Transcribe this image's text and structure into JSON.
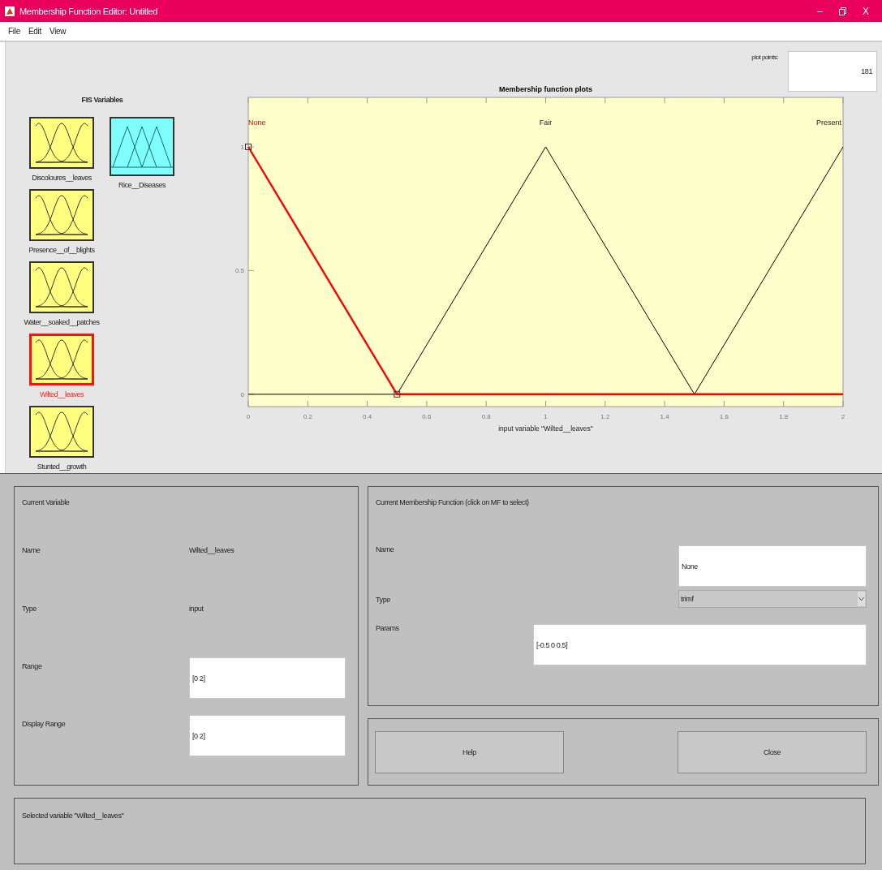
{
  "window": {
    "title": "Membership Function Editor: Untitled",
    "minimize": "–",
    "close": "X"
  },
  "menu": [
    "File",
    "Edit",
    "View"
  ],
  "fis_variables": {
    "title": "FIS Variables",
    "items": [
      {
        "name": "Discoloures__leaves",
        "kind": "input",
        "selected": false
      },
      {
        "name": "Presence__of__blights",
        "kind": "input",
        "selected": false
      },
      {
        "name": "Water__soaked__patches",
        "kind": "input",
        "selected": false
      },
      {
        "name": "Wilted__leaves",
        "kind": "input",
        "selected": true
      },
      {
        "name": "Stunted__growth",
        "kind": "input",
        "selected": false
      },
      {
        "name": "Rice__Diseases",
        "kind": "output",
        "selected": false
      }
    ]
  },
  "plot_points": {
    "label": "plot points:",
    "value": "181"
  },
  "plot": {
    "membership_functions": [
      {
        "name": "None",
        "selected": true
      },
      {
        "name": "Fair",
        "selected": false
      },
      {
        "name": "Present",
        "selected": false
      }
    ],
    "chart_data": {
      "type": "line",
      "title": "Membership function plots",
      "xlabel": "input variable \"Wilted__leaves\"",
      "x": [
        0,
        0.5,
        1,
        1.5,
        2
      ],
      "series": [
        {
          "color": "#ff0000",
          "values": [
            1,
            0,
            0,
            0,
            0
          ]
        },
        {
          "color": "#000000",
          "values": [
            0,
            0,
            1,
            0,
            null
          ]
        },
        {
          "color": "#000000",
          "values": [
            null,
            null,
            null,
            0,
            1
          ]
        }
      ],
      "xlim": [
        0,
        2
      ],
      "ylim": [
        -0.05,
        1.2
      ],
      "xticks": [
        0,
        0.2,
        0.4,
        0.6,
        0.8,
        1,
        1.2,
        1.4,
        1.6,
        1.8,
        2
      ],
      "yticks": [
        0,
        0.5,
        1
      ]
    }
  },
  "current_variable": {
    "title": "Current Variable",
    "name_label": "Name",
    "name": "Wilted__leaves",
    "type_label": "Type",
    "type": "input",
    "range_label": "Range",
    "range": "[0 2]",
    "display_range_label": "Display Range",
    "display_range": "[0 2]"
  },
  "current_mf": {
    "title": "Current Membership Function (click on MF to select)",
    "name_label": "Name",
    "name": "None",
    "type_label": "Type",
    "type": "trimf",
    "params_label": "Params",
    "params": "[-0.5 0 0.5]"
  },
  "buttons": [
    "Help",
    "Close"
  ],
  "status": "Selected variable \"Wilted__leaves\""
}
